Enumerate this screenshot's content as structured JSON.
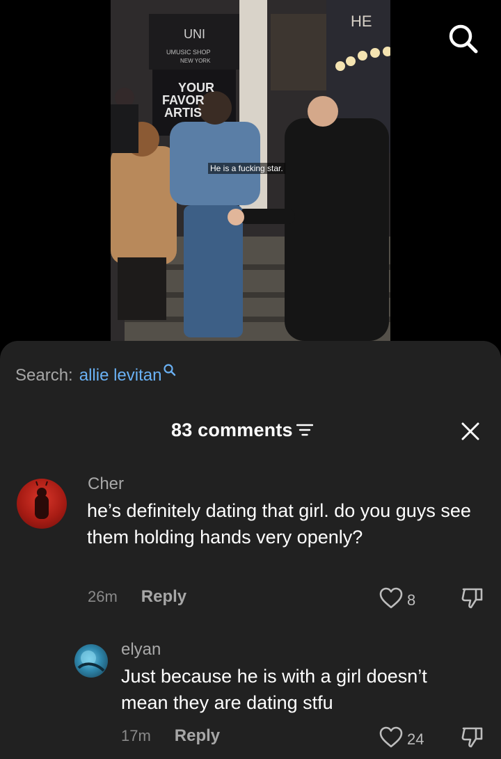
{
  "video": {
    "caption": "He is a fucking star.",
    "search_icon": "search-icon"
  },
  "panel": {
    "search_label": "Search:",
    "search_term": "allie levitan",
    "comments_count": "83 comments",
    "filter_icon": "filter-icon",
    "close_icon": "close-icon"
  },
  "comments": [
    {
      "username": "Cher",
      "text": "he’s definitely dating that girl. do you guys see them holding hands very openly?",
      "time": "26m",
      "reply_label": "Reply",
      "likes": "8"
    },
    {
      "username": "elyan",
      "text": "Just because he is with a girl doesn’t mean they are dating stfu",
      "time": "17m",
      "reply_label": "Reply",
      "likes": "24"
    }
  ],
  "colors": {
    "panel_bg": "#212121",
    "link_blue": "#6ab1f4",
    "muted_text": "#a7a7a7"
  }
}
